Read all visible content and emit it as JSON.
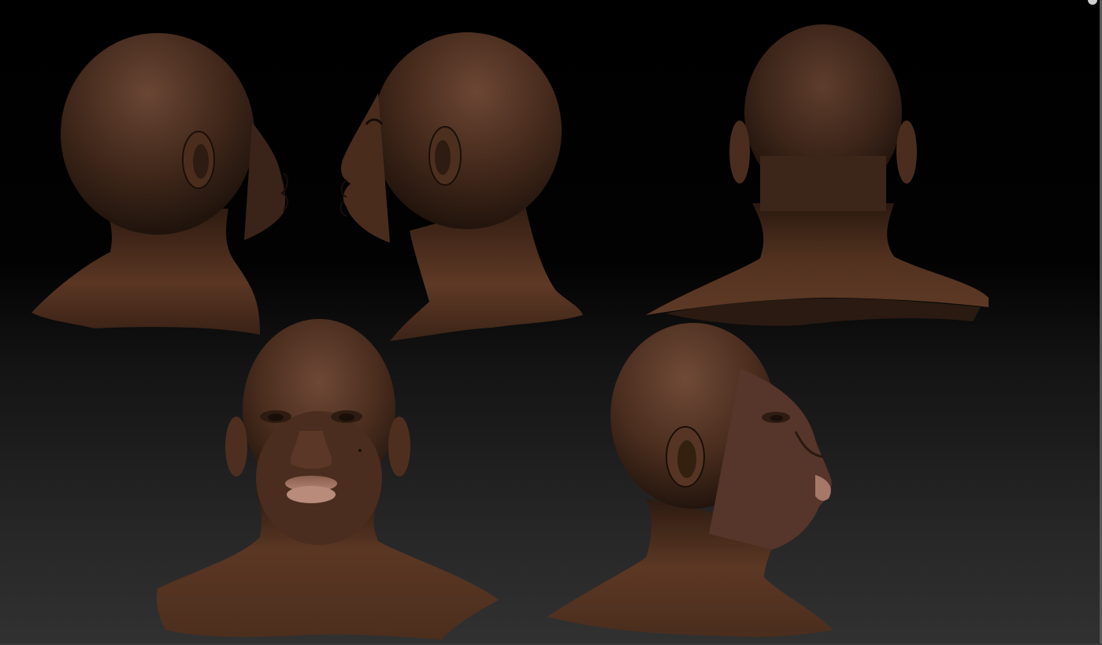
{
  "scene": {
    "background_top": "#000000",
    "background_bottom": "#313131",
    "skin_base": "#4e3020",
    "skin_highlight": "#7a4d34",
    "skin_shadow": "#24150d",
    "lip_color": "#a87766"
  },
  "renders": [
    {
      "view": "left-rear-three-quarter",
      "icon": "head-left-rear-render"
    },
    {
      "view": "right-profile",
      "icon": "head-right-profile-render"
    },
    {
      "view": "back",
      "icon": "head-back-render"
    },
    {
      "view": "front",
      "icon": "head-front-render"
    },
    {
      "view": "right-three-quarter",
      "icon": "head-right-three-quarter-render"
    }
  ]
}
